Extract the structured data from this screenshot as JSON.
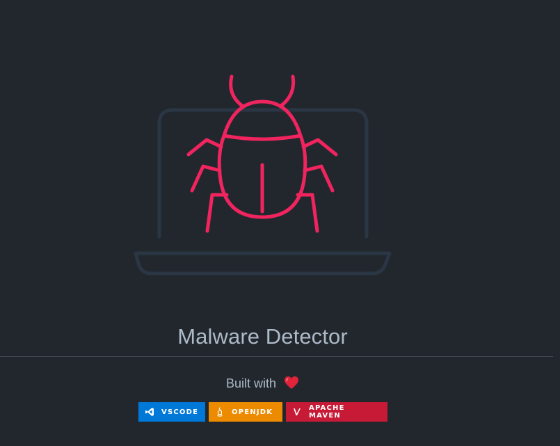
{
  "hero": {
    "icon": "bug-on-laptop-icon",
    "colors": {
      "bug": "#f0245e",
      "laptop": "#2a3644",
      "background": "#22272e"
    }
  },
  "title": "Malware Detector",
  "built_with": {
    "label": "Built with",
    "icon": "heart-icon",
    "heart_color": "#e0243a"
  },
  "badges": [
    {
      "label": "VSCODE",
      "icon": "vscode-icon",
      "color": "#0078d7"
    },
    {
      "label": "OPENJDK",
      "icon": "openjdk-icon",
      "color": "#ec8b00"
    },
    {
      "label": "APACHE MAVEN",
      "icon": "apache-maven-icon",
      "color": "#c71a36"
    }
  ]
}
